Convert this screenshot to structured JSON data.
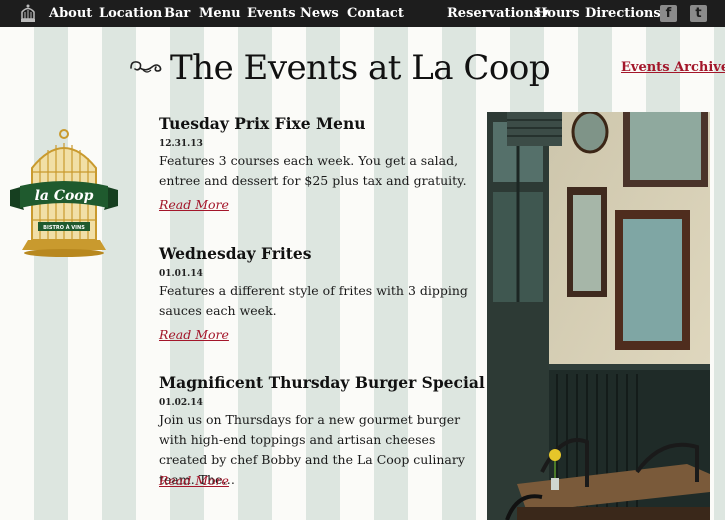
{
  "nav": {
    "items": [
      "About",
      "Location",
      "Bar",
      "Menu",
      "Events",
      "News",
      "Contact"
    ],
    "reservations": "Reservations",
    "hours": "Hours",
    "directions": "Directions",
    "social": [
      {
        "icon": "facebook-icon",
        "glyph": "f"
      },
      {
        "icon": "twitter-icon",
        "glyph": "t"
      }
    ]
  },
  "page": {
    "title": "The Events at La Coop",
    "archive_link": "Events Archive"
  },
  "logo": {
    "name": "la Coop",
    "tagline": "BISTRO À VINS"
  },
  "events": [
    {
      "title": "Tuesday Prix Fixe Menu",
      "date": "12.31.13",
      "description": "Features 3 courses each week. You get a salad, entree and dessert for $25 plus tax and gratuity.",
      "link": "Read More"
    },
    {
      "title": "Wednesday Frites",
      "date": "01.01.14",
      "description": "Features a different style of frites with 3 dipping sauces each week.",
      "link": "Read More"
    },
    {
      "title": "Magnificent Thursday Burger Special",
      "date": "01.02.14",
      "description": "Join us on Thursdays for a new gourmet burger with high-end toppings and artisan cheeses created by chef Bobby and the La Coop culinary team. The…",
      "link": "Read More"
    }
  ],
  "colors": {
    "nav_bg": "#1d1d1d",
    "accent_red": "#a3162a",
    "stripe": "#dde6e0",
    "logo_green": "#1f5a2e",
    "logo_gold": "#c99a2e"
  }
}
